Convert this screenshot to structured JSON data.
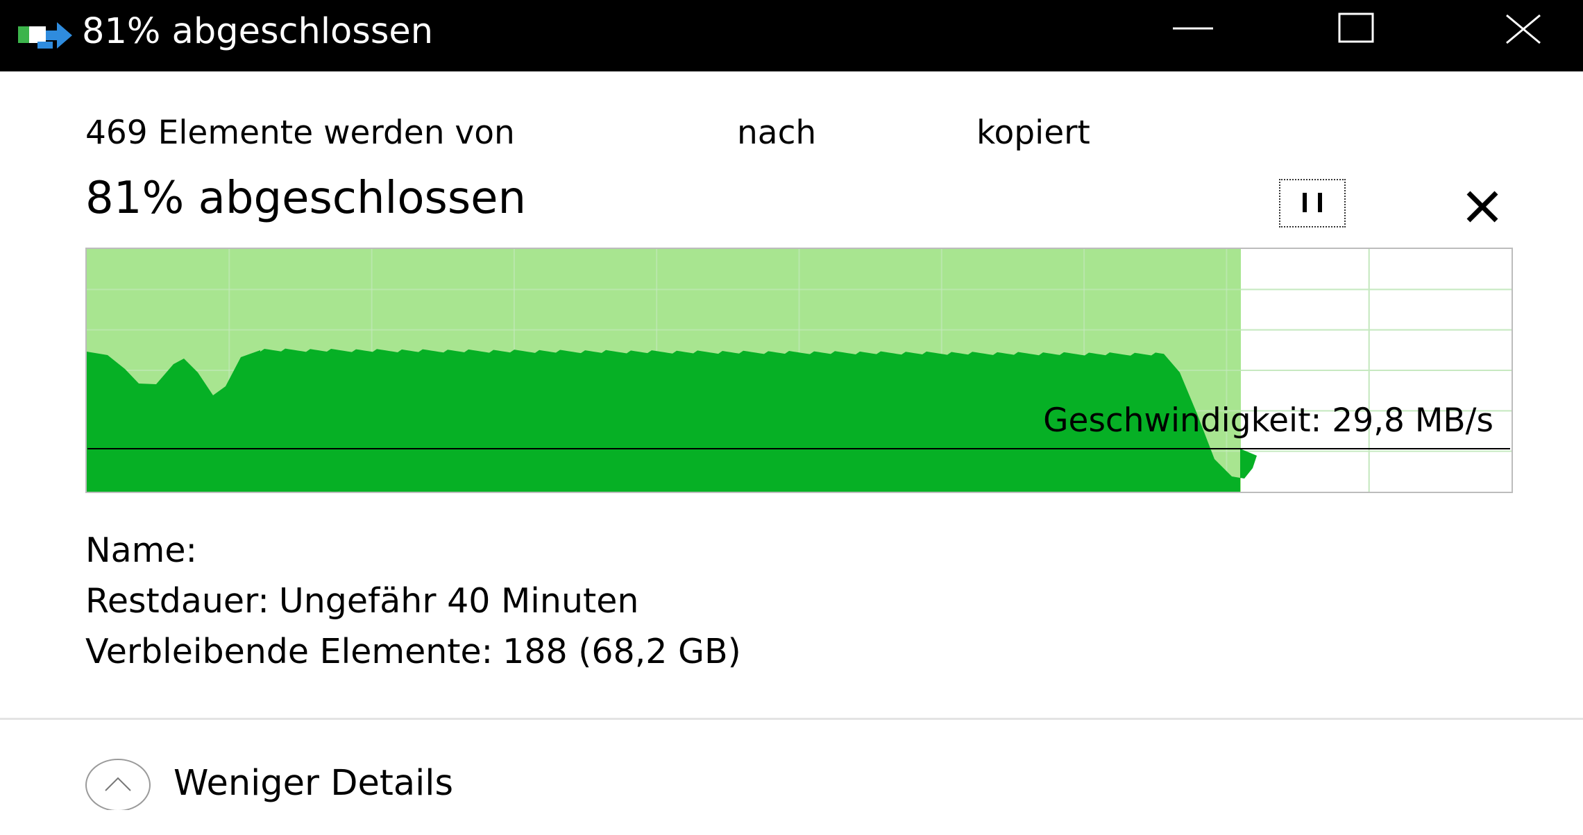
{
  "window": {
    "title": "81% abgeschlossen",
    "title_icon": "file-copy-icon",
    "controls": {
      "minimize_icon": "minimize-icon",
      "maximize_icon": "maximize-icon",
      "close_icon": "close-icon"
    }
  },
  "header": {
    "copy_from_text": "469 Elemente werden von",
    "copy_to_text": "nach",
    "copied_text": "kopiert",
    "progress_text": "81% abgeschlossen",
    "pause_icon": "pause-icon",
    "cancel_icon": "cancel-icon"
  },
  "graph": {
    "progress_percent": 81,
    "speed_label": "Geschwindigkeit: 29,8 MB/s",
    "colors": {
      "done_background": "#a8e590",
      "speed_fill": "#06b025",
      "grid_line": "#c7e9c1",
      "border": "#bcbcbc",
      "speed_line": "#000000"
    }
  },
  "details": {
    "name_label": "Name:",
    "name_value": "",
    "remaining_time_label": "Restdauer:",
    "remaining_time_value": "Ungefähr 40 Minuten",
    "remaining_items_label": "Verbleibende Elemente:",
    "remaining_items_value": "188 (68,2 GB)"
  },
  "footer": {
    "toggle_label": "Weniger Details",
    "toggle_icon": "chevron-up-icon"
  }
}
